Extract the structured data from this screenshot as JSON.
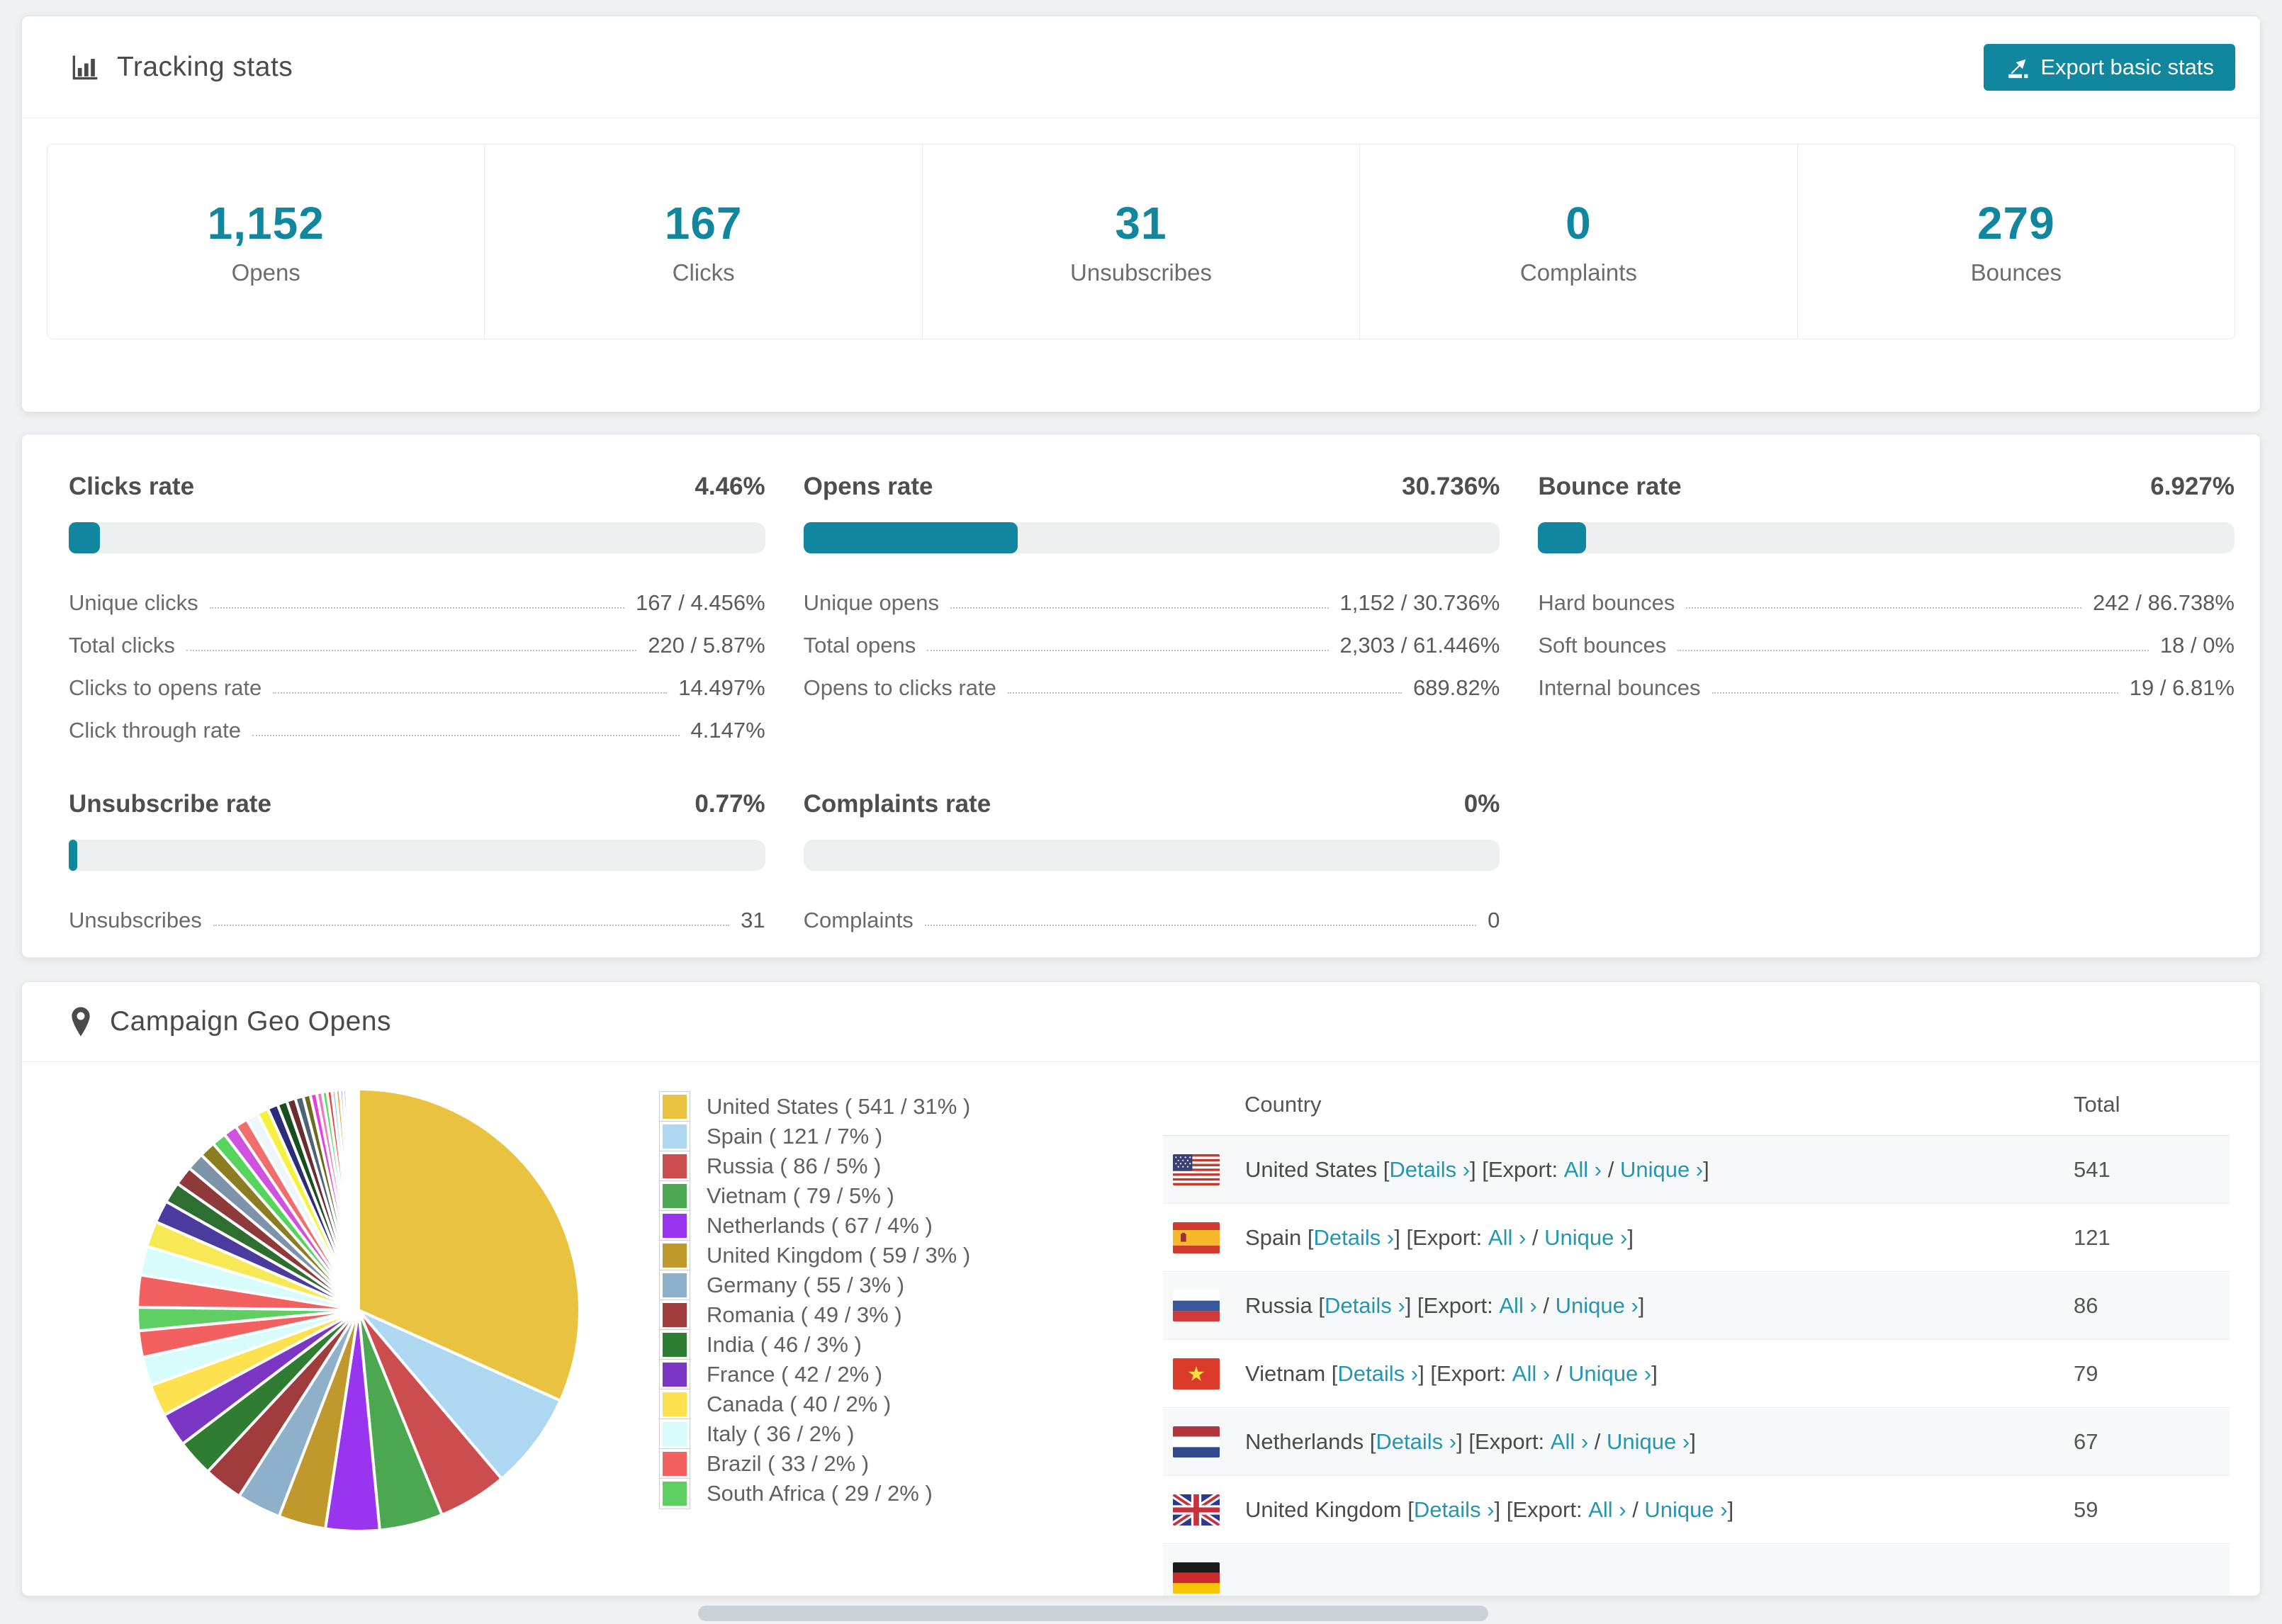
{
  "accent_color": "#10879e",
  "link_color": "#2596b2",
  "header": {
    "title": "Tracking stats",
    "export_button": "Export basic stats"
  },
  "summary": [
    {
      "value": "1,152",
      "label": "Opens"
    },
    {
      "value": "167",
      "label": "Clicks"
    },
    {
      "value": "31",
      "label": "Unsubscribes"
    },
    {
      "value": "0",
      "label": "Complaints"
    },
    {
      "value": "279",
      "label": "Bounces"
    }
  ],
  "rates": [
    {
      "title": "Clicks rate",
      "value": "4.46%",
      "percent": 4.46,
      "rows": [
        {
          "label": "Unique clicks",
          "value": "167 / 4.456%"
        },
        {
          "label": "Total clicks",
          "value": "220 / 5.87%"
        },
        {
          "label": "Clicks to opens rate",
          "value": "14.497%"
        },
        {
          "label": "Click through rate",
          "value": "4.147%"
        }
      ]
    },
    {
      "title": "Opens rate",
      "value": "30.736%",
      "percent": 30.736,
      "rows": [
        {
          "label": "Unique opens",
          "value": "1,152 / 30.736%"
        },
        {
          "label": "Total opens",
          "value": "2,303 / 61.446%"
        },
        {
          "label": "Opens to clicks rate",
          "value": "689.82%"
        }
      ]
    },
    {
      "title": "Bounce rate",
      "value": "6.927%",
      "percent": 6.927,
      "rows": [
        {
          "label": "Hard bounces",
          "value": "242 / 86.738%"
        },
        {
          "label": "Soft bounces",
          "value": "18 / 0%"
        },
        {
          "label": "Internal bounces",
          "value": "19 / 6.81%"
        }
      ]
    },
    {
      "title": "Unsubscribe rate",
      "value": "0.77%",
      "percent": 0.77,
      "rows": [
        {
          "label": "Unsubscribes",
          "value": "31"
        }
      ]
    },
    {
      "title": "Complaints rate",
      "value": "0%",
      "percent": 0,
      "rows": [
        {
          "label": "Complaints",
          "value": "0"
        }
      ]
    }
  ],
  "geo": {
    "title": "Campaign Geo Opens",
    "legend": [
      {
        "label": "United States ( 541 / 31% )",
        "color": "#e9c23f"
      },
      {
        "label": "Spain ( 121 / 7% )",
        "color": "#aed7f2"
      },
      {
        "label": "Russia ( 86 / 5% )",
        "color": "#cc4d4d"
      },
      {
        "label": "Vietnam ( 79 / 5% )",
        "color": "#4ba850"
      },
      {
        "label": "Netherlands ( 67 / 4% )",
        "color": "#9a35ef"
      },
      {
        "label": "United Kingdom ( 59 / 3% )",
        "color": "#bf992b"
      },
      {
        "label": "Germany ( 55 / 3% )",
        "color": "#8fb0ca"
      },
      {
        "label": "Romania ( 49 / 3% )",
        "color": "#a03c3c"
      },
      {
        "label": "India ( 46 / 3% )",
        "color": "#2f7d32"
      },
      {
        "label": "France ( 42 / 2% )",
        "color": "#7c36c4"
      },
      {
        "label": "Canada ( 40 / 2% )",
        "color": "#fee14e"
      },
      {
        "label": "Italy ( 36 / 2% )",
        "color": "#d8fbfb"
      },
      {
        "label": "Brazil ( 33 / 2% )",
        "color": "#f2605f"
      },
      {
        "label": "South Africa ( 29 / 2% )",
        "color": "#5fce63"
      }
    ],
    "table": {
      "columns": [
        "Country",
        "Total"
      ],
      "link_labels": {
        "details": "Details ›",
        "export_prefix": "Export:",
        "all": "All ›",
        "unique": "Unique ›"
      },
      "rows": [
        {
          "flag": "us",
          "country": "United States",
          "total": "541"
        },
        {
          "flag": "es",
          "country": "Spain",
          "total": "121"
        },
        {
          "flag": "ru",
          "country": "Russia",
          "total": "86"
        },
        {
          "flag": "vn",
          "country": "Vietnam",
          "total": "79"
        },
        {
          "flag": "nl",
          "country": "Netherlands",
          "total": "67"
        },
        {
          "flag": "gb",
          "country": "United Kingdom",
          "total": "59"
        },
        {
          "flag": "de",
          "country": "",
          "total": ""
        }
      ]
    }
  },
  "chart_data": {
    "type": "pie",
    "title": "Campaign Geo Opens",
    "unit": "opens",
    "start_angle_deg": 0,
    "direction": "clockwise",
    "legend_position": "right",
    "slices": [
      {
        "label": "United States",
        "value": 541,
        "pct": "31%",
        "color": "#e9c23f"
      },
      {
        "label": "Spain",
        "value": 121,
        "pct": "7%",
        "color": "#aed7f2"
      },
      {
        "label": "Russia",
        "value": 86,
        "pct": "5%",
        "color": "#cc4d4d"
      },
      {
        "label": "Vietnam",
        "value": 79,
        "pct": "5%",
        "color": "#4ba850"
      },
      {
        "label": "Netherlands",
        "value": 67,
        "pct": "4%",
        "color": "#9a35ef"
      },
      {
        "label": "United Kingdom",
        "value": 59,
        "pct": "3%",
        "color": "#bf992b"
      },
      {
        "label": "Germany",
        "value": 55,
        "pct": "3%",
        "color": "#8fb0ca"
      },
      {
        "label": "Romania",
        "value": 49,
        "pct": "3%",
        "color": "#a03c3c"
      },
      {
        "label": "India",
        "value": 46,
        "pct": "3%",
        "color": "#2f7d32"
      },
      {
        "label": "France",
        "value": 42,
        "pct": "2%",
        "color": "#7c36c4"
      },
      {
        "label": "Canada",
        "value": 40,
        "pct": "2%",
        "color": "#fee14e"
      },
      {
        "label": "Italy",
        "value": 36,
        "pct": "2%",
        "color": "#d8fbfb"
      },
      {
        "label": "Brazil",
        "value": 33,
        "pct": "2%",
        "color": "#f2605f"
      },
      {
        "label": "South Africa",
        "value": 29,
        "pct": "2%",
        "color": "#5fce63"
      }
    ],
    "others_unlabeled": {
      "values": [
        40,
        36,
        32,
        28,
        26,
        24,
        22,
        20,
        18,
        17,
        16,
        15,
        14,
        13,
        12,
        11,
        10,
        9,
        8,
        7,
        6,
        6,
        5,
        5,
        4,
        4,
        3,
        3,
        2,
        2,
        2,
        1,
        1,
        1
      ],
      "colors": [
        "#f2605f",
        "#d8fbfb",
        "#f7e955",
        "#4a3b9f",
        "#2f6e31",
        "#8f3a3a",
        "#7d93a8",
        "#8a7d22",
        "#57d45c",
        "#cf52e0",
        "#f26d6d",
        "#eef6fb",
        "#f5f23e",
        "#2c2c7a",
        "#17501e",
        "#6b2d2d",
        "#4e6474",
        "#6b6b1d",
        "#e23ee2",
        "#f773c2",
        "#52e052",
        "#e04545",
        "#9fc8ef",
        "#d9a62e",
        "#7b3bd4",
        "#3ea3d6",
        "#74e8a0",
        "#c22e86",
        "#e77e35",
        "#5555e0",
        "#8fe03a",
        "#d44a9e",
        "#49c9b8",
        "#e9c13d"
      ]
    }
  }
}
